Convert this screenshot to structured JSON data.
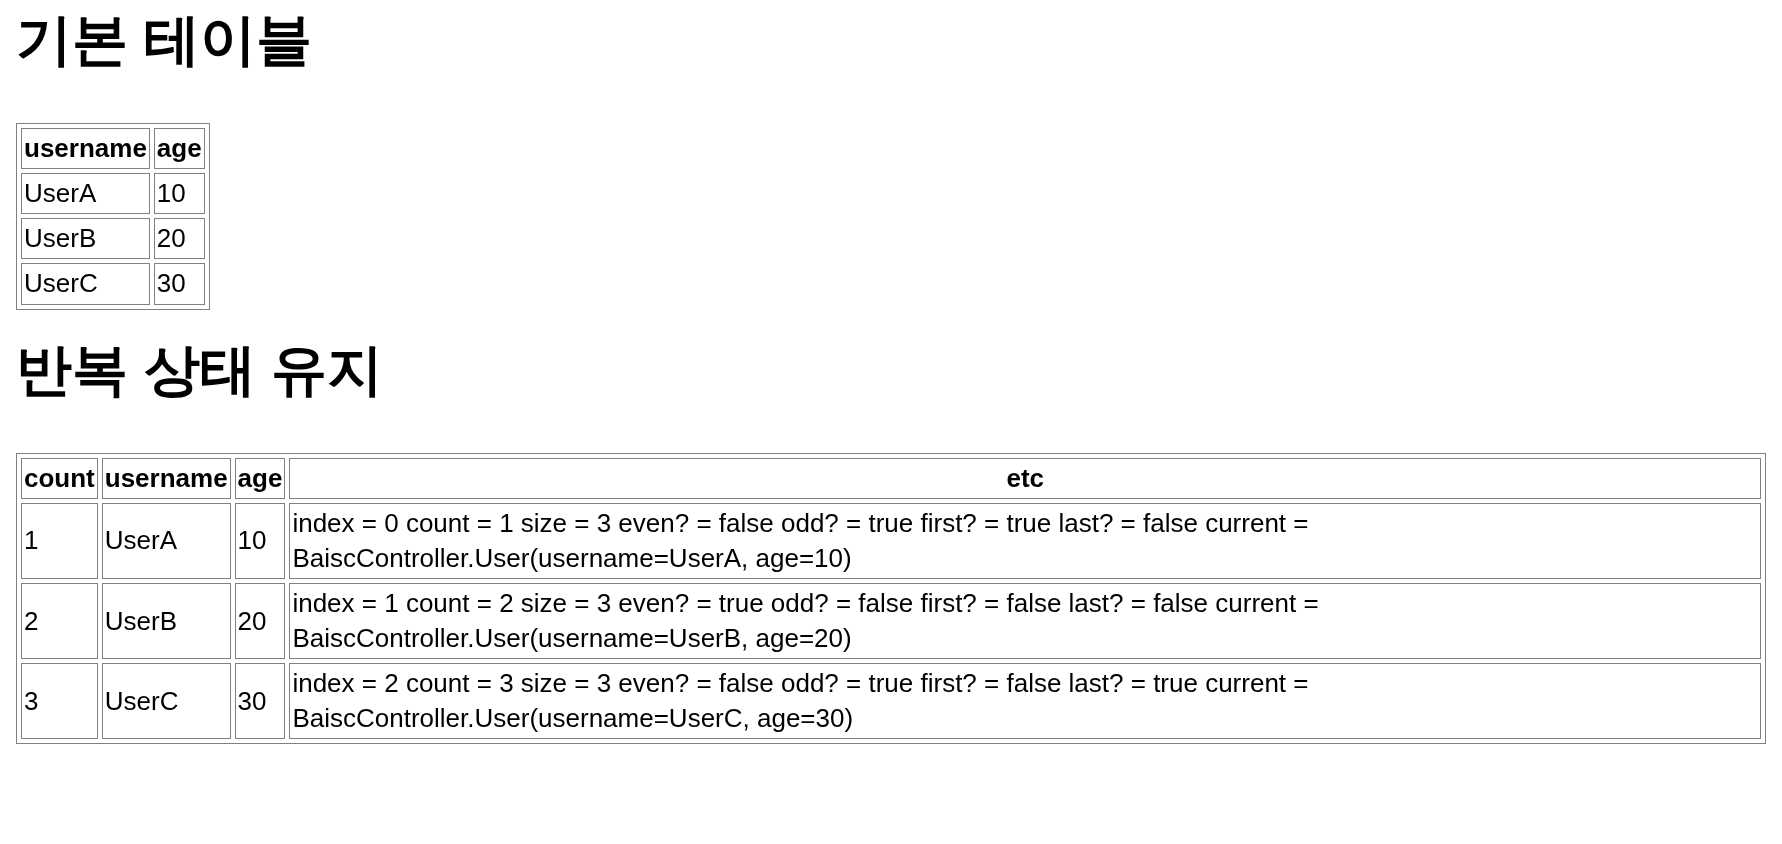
{
  "sections": [
    {
      "heading": "기본 테이블",
      "table": {
        "columns": [
          "username",
          "age"
        ],
        "rows": [
          [
            "UserA",
            "10"
          ],
          [
            "UserB",
            "20"
          ],
          [
            "UserC",
            "30"
          ]
        ]
      }
    },
    {
      "heading": "반복 상태 유지",
      "table": {
        "columns": [
          "count",
          "username",
          "age",
          "etc"
        ],
        "rows": [
          [
            "1",
            "UserA",
            "10",
            "index = 0 count = 1 size = 3 even? = false odd? = true first? = true last? = false current = BaiscController.User(username=UserA, age=10)"
          ],
          [
            "2",
            "UserB",
            "20",
            "index = 1 count = 2 size = 3 even? = true odd? = false first? = false last? = false current = BaiscController.User(username=UserB, age=20)"
          ],
          [
            "3",
            "UserC",
            "30",
            "index = 2 count = 3 size = 3 even? = false odd? = true first? = false last? = true current = BaiscController.User(username=UserC, age=30)"
          ]
        ]
      }
    }
  ]
}
